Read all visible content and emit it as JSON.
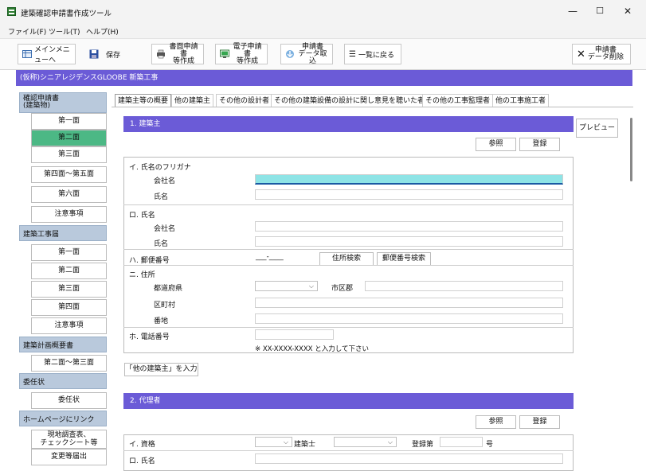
{
  "window": {
    "title": "建築確認申請書作成ツール",
    "min": "—",
    "max": "☐",
    "close": "✕"
  },
  "menu": [
    "ファイル(F)",
    "ツール(T)",
    "ヘルプ(H)"
  ],
  "toolbar": {
    "main_menu": "メインメニューへ",
    "save": "保存",
    "paper_1": "書面申請書",
    "paper_2": "等作成",
    "elec_1": "電子申請書",
    "elec_2": "等作成",
    "import_1": "申請書",
    "import_2": "データ取込",
    "back_list": "一覧に戻る",
    "delete_1": "申請書",
    "delete_2": "データ削除"
  },
  "project": "(仮称)シニアレジデンスGLOOBE 新築工事",
  "sidebar": {
    "g1": "確認申請書",
    "g1b": "(建築物)",
    "g1_items": [
      "第一面",
      "第二面",
      "第三面",
      "第四面～第五面",
      "第六面",
      "注意事項"
    ],
    "g2": "建築工事届",
    "g2_items": [
      "第一面",
      "第二面",
      "第三面",
      "第四面",
      "注意事項"
    ],
    "g3": "建築計画概要書",
    "g3_items": [
      "第二面～第三面"
    ],
    "g4": "委任状",
    "g4_items": [
      "委任状"
    ],
    "g5": "ホームページにリンク",
    "g5_a1": "現地調査表、",
    "g5_a2": "チェックシート等",
    "g5_b": "変更等届出"
  },
  "tabs": [
    "建築主等の概要",
    "他の建築主",
    "その他の設計者",
    "その他の建築設備の設計に関し意見を聴いた者",
    "その他の工事監理者",
    "他の工事施工者"
  ],
  "preview": "プレビュー",
  "s1": {
    "title": "1. 建築主",
    "ref": "参照",
    "reg": "登録",
    "furigana": "イ. 氏名のフリガナ",
    "company": "会社名",
    "name": "氏名",
    "ro": "ロ. 氏名",
    "company2": "会社名",
    "name2": "氏名",
    "zip": "ハ. 郵便番号",
    "zip_val": "___-____",
    "addr_search": "住所検索",
    "zip_search": "郵便番号検索",
    "address": "ニ. 住所",
    "pref": "都道府県",
    "city": "市区郡",
    "town": "区町村",
    "banchi": "番地",
    "tel": "ホ. 電話番号",
    "tel_note": "※ XX-XXXX-XXXX と入力して下さい",
    "other_btn": "「他の建築主」を入力"
  },
  "s2": {
    "title": "2. 代理者",
    "ref": "参照",
    "reg": "登録",
    "qual": "イ. 資格",
    "kenchikushi": "建築士",
    "reg_no": "登録第",
    "go": "号",
    "ro": "ロ. 氏名"
  },
  "colors": {
    "accent": "#6b5bd7",
    "selected": "#4cb885",
    "sidebar_head": "#b9c9dc"
  }
}
